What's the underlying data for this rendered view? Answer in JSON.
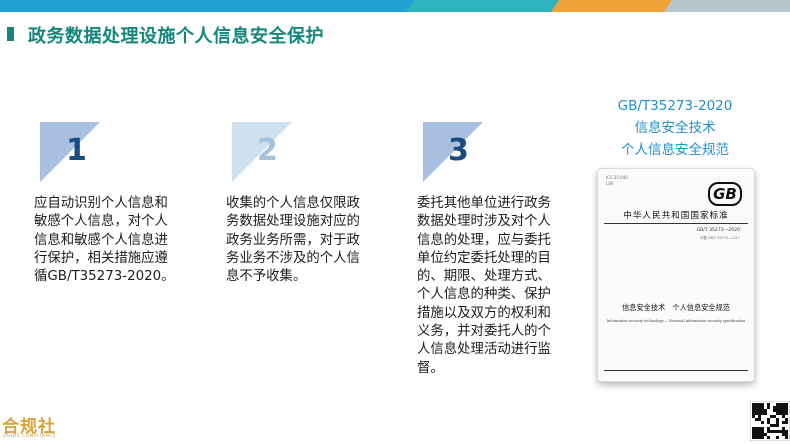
{
  "header": {
    "title": "政务数据处理设施个人信息安全保护",
    "accent_colors": [
      "#1fa1d3",
      "#2fb3bf",
      "#f1a33a",
      "#b7c6c8"
    ],
    "title_color": "#14867c"
  },
  "steps": [
    {
      "number": "1",
      "lines": [
        "应自动识别个人信息和",
        "敏感个人信息，对个人",
        "信息和敏感个人信息进",
        "行保护，相关措施应遵",
        "循GB/T35273-2020。"
      ]
    },
    {
      "number": "2",
      "lines": [
        "收集的个人信息仅限政",
        "务数据处理设施对应的",
        "政务业务所需，对于政",
        "务业务不涉及的个人信",
        "息不予收集。"
      ]
    },
    {
      "number": "3",
      "lines": [
        "委托其他单位进行政务",
        "数据处理时涉及对个人",
        "信息的处理，应与委托",
        "单位约定委托处理的目",
        "的、期限、处理方式、",
        "个人信息的种类、保护",
        "措施以及双方的权利和",
        "义务，并对委托人的个",
        "人信息处理活动进行监",
        "督。"
      ]
    }
  ],
  "standard": {
    "code": "GB/T35273-2020",
    "line2": "信息安全技术",
    "line3": "个人信息安全规范",
    "cover": {
      "small_1": "ICS 35.040",
      "small_2": "L80",
      "logo": "GB",
      "country": "中华人民共和国国家标准",
      "doc_code": "GB/T 35273—2020",
      "replaces": "代替 GB/T 35273—2017",
      "cn_title": "信息安全技术　个人信息安全规范",
      "en_title": "Information security technology — Personal information security specification"
    }
  },
  "brand": {
    "name": "合规社",
    "sub": "GUIDE COMPLIANCE",
    "color": "#d9a33a"
  }
}
